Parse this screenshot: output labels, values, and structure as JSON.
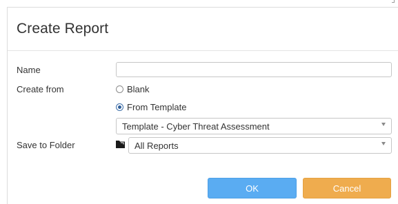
{
  "dialog": {
    "title": "Create Report",
    "fields": {
      "name_label": "Name",
      "name_value": "",
      "create_from_label": "Create from",
      "option_blank": "Blank",
      "option_template": "From Template",
      "selected_option": "From Template",
      "template_value": "Template - Cyber Threat Assessment",
      "save_to_folder_label": "Save to Folder",
      "folder_value": "All Reports"
    },
    "buttons": {
      "ok": "OK",
      "cancel": "Cancel"
    }
  },
  "colors": {
    "ok_button": "#5aacf2",
    "cancel_button": "#efac4e",
    "radio_selected": "#2f5f9a"
  },
  "icons": {
    "folder": "folder-icon",
    "dropdown": "chevron-down-icon"
  }
}
